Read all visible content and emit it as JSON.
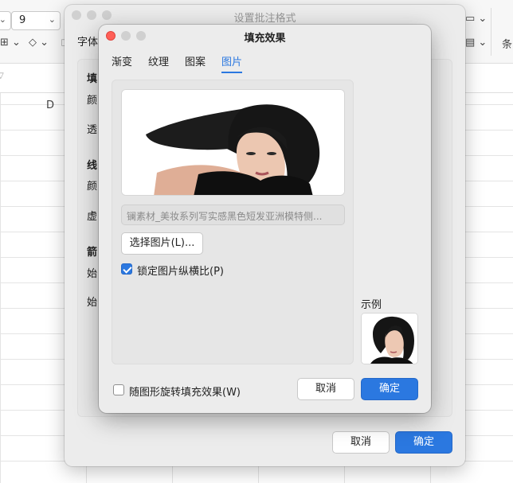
{
  "ribbon": {
    "font_size": "9",
    "right_label": "条",
    "formula_marker": "▽",
    "column": "D"
  },
  "format_dialog": {
    "title": "设置批注格式",
    "first_tab": "字体",
    "labels": [
      "填",
      "颜",
      "透",
      "线",
      "颜",
      "虚",
      "箭",
      "始",
      "始"
    ],
    "cancel": "取消",
    "ok": "确定"
  },
  "fill_dialog": {
    "title": "填充效果",
    "tabs": [
      {
        "label": "渐变",
        "active": false
      },
      {
        "label": "纹理",
        "active": false
      },
      {
        "label": "图案",
        "active": false
      },
      {
        "label": "图片",
        "active": true
      }
    ],
    "filename": "镧素材_美妆系列写实感黑色短发亚洲模特侧...",
    "select_picture": "选择图片(L)...",
    "lock_ratio": {
      "label": "锁定图片纵横比(P)",
      "checked": true
    },
    "sample_label": "示例",
    "rotate_with_shape": {
      "label": "随图形旋转填充效果(W)",
      "checked": false
    },
    "cancel": "取消",
    "ok": "确定"
  },
  "colors": {
    "accent": "#2b78e0",
    "close": "#ff5f57",
    "inactive_light": "#d0d0d0"
  }
}
